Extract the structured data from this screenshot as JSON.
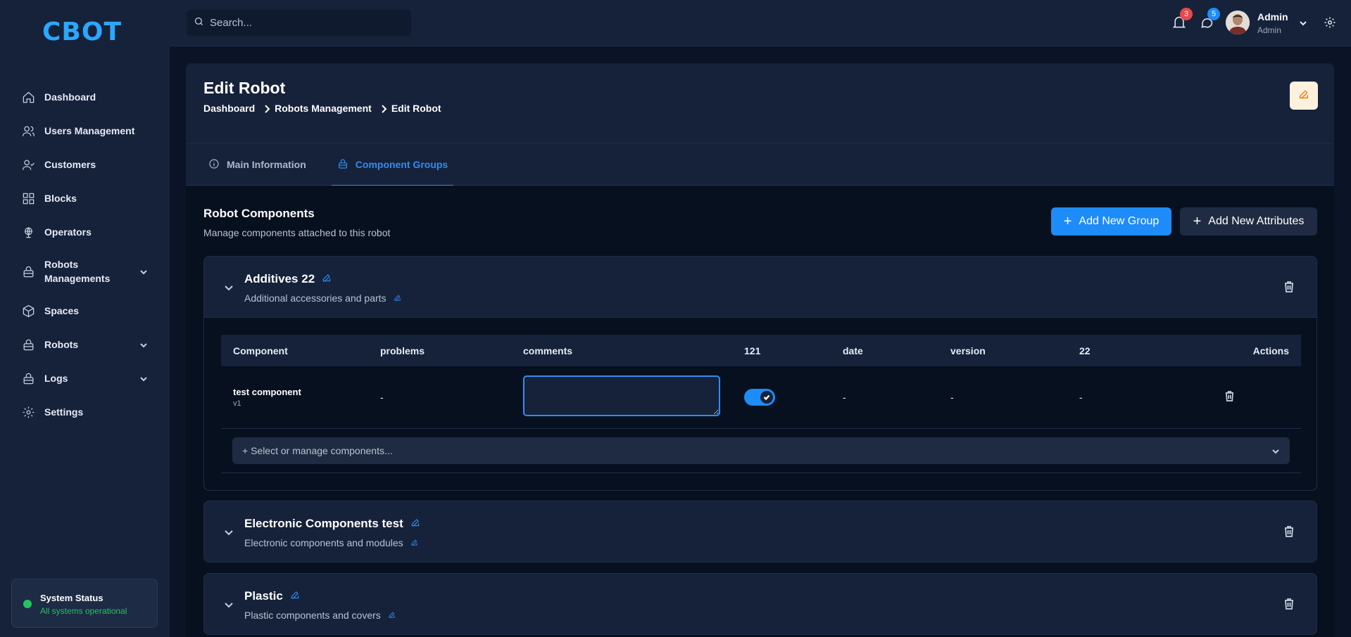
{
  "app": {
    "logo": "CBOT"
  },
  "sidebar": {
    "items": [
      {
        "label": "Dashboard",
        "icon": "home-icon"
      },
      {
        "label": "Users Management",
        "icon": "users-icon"
      },
      {
        "label": "Customers",
        "icon": "user-check-icon"
      },
      {
        "label": "Blocks",
        "icon": "grid-icon"
      },
      {
        "label": "Operators",
        "icon": "globe-icon"
      },
      {
        "label": "Robots Managements",
        "icon": "lock-icon",
        "expandable": true
      },
      {
        "label": "Spaces",
        "icon": "cube-icon"
      },
      {
        "label": "Robots",
        "icon": "lock-icon",
        "expandable": true
      },
      {
        "label": "Logs",
        "icon": "lock-icon",
        "expandable": true
      },
      {
        "label": "Settings",
        "icon": "gear-icon"
      }
    ],
    "status": {
      "title": "System Status",
      "subtitle": "All systems operational",
      "color": "#22c55e"
    }
  },
  "topbar": {
    "search_placeholder": "Search...",
    "notifications_count": "3",
    "messages_count": "5",
    "user_name": "Admin",
    "user_role": "Admin"
  },
  "page": {
    "title": "Edit Robot",
    "breadcrumb": [
      "Dashboard",
      "Robots Management",
      "Edit Robot"
    ],
    "tabs": [
      {
        "label": "Main Information",
        "icon": "info-icon"
      },
      {
        "label": "Component Groups",
        "icon": "lock-icon",
        "active": true
      }
    ]
  },
  "section": {
    "title": "Robot Components",
    "subtitle": "Manage components attached to this robot",
    "add_group_label": "Add New Group",
    "add_attributes_label": "Add New Attributes"
  },
  "groups": [
    {
      "title": "Additives 22",
      "subtitle": "Additional accessories and parts",
      "expanded": true,
      "table": {
        "columns": [
          "Component",
          "problems",
          "comments",
          "121",
          "date",
          "version",
          "22",
          "Actions"
        ],
        "rows": [
          {
            "name": "test component",
            "version_tag": "v1",
            "problems": "-",
            "comments": "",
            "toggle_121": true,
            "date": "-",
            "version": "-",
            "col_22": "-"
          }
        ]
      },
      "select_placeholder": "+ Select or manage components..."
    },
    {
      "title": "Electronic Components test",
      "subtitle": "Electronic components and modules",
      "expanded": false
    },
    {
      "title": "Plastic",
      "subtitle": "Plastic components and covers",
      "expanded": false
    }
  ],
  "colors": {
    "accent": "#1d8cf8",
    "notif_badge": "#e5484d",
    "msg_badge": "#1d8cf8",
    "edit_button_bg": "#fdf0dc",
    "edit_button_icon": "#ea7a12"
  }
}
